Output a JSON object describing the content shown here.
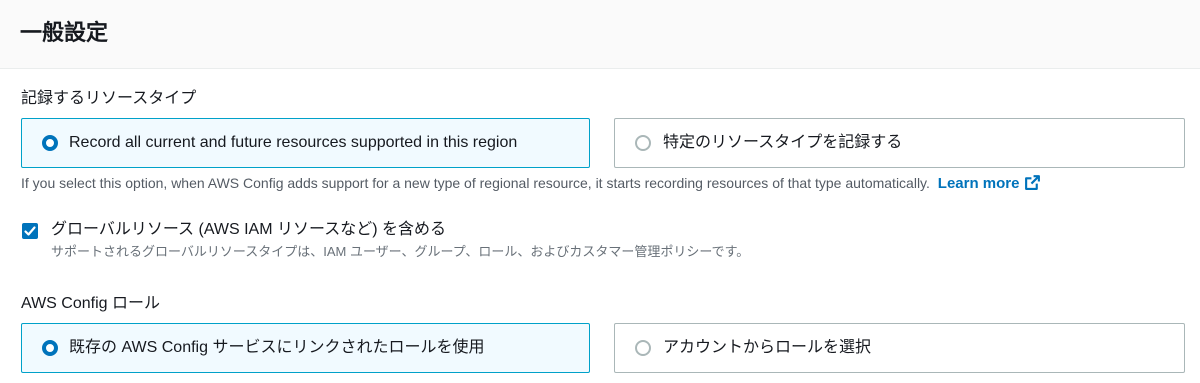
{
  "panel": {
    "title": "一般設定"
  },
  "resource_types": {
    "label": "記録するリソースタイプ",
    "options": [
      {
        "label": "Record all current and future resources supported in this region",
        "selected": true
      },
      {
        "label": "特定のリソースタイプを記録する",
        "selected": false
      }
    ],
    "description": "If you select this option, when AWS Config adds support for a new type of regional resource, it starts recording resources of that type automatically.",
    "learn_more": "Learn more",
    "learn_more_icon": "external-link-icon"
  },
  "global_resources": {
    "checked": true,
    "label": "グローバルリソース (AWS IAM リソースなど) を含める",
    "description": "サポートされるグローバルリソースタイプは、IAM ユーザー、グループ、ロール、およびカスタマー管理ポリシーです。"
  },
  "config_role": {
    "label": "AWS Config ロール",
    "options": [
      {
        "label": "既存の AWS Config サービスにリンクされたロールを使用",
        "selected": true
      },
      {
        "label": "アカウントからロールを選択",
        "selected": false
      }
    ]
  },
  "colors": {
    "accent": "#0073bb",
    "selected_border": "#00a1c9",
    "selected_bg": "#f1faff"
  }
}
